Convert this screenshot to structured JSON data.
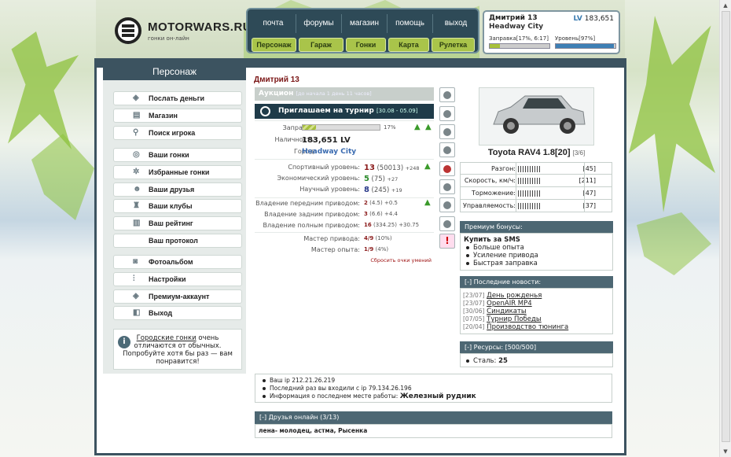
{
  "logo": {
    "name": "MOTORWARS.RU",
    "tagline": "гонки он-лайн"
  },
  "nav": {
    "top": [
      "почта",
      "форумы",
      "магазин",
      "помощь",
      "выход"
    ],
    "buttons": [
      "Персонаж",
      "Гараж",
      "Гонки",
      "Карта",
      "Рулетка"
    ]
  },
  "user": {
    "name": "Дмитрий 13",
    "lv_label": "LV",
    "lv": "183,651",
    "city": "Headway City",
    "fuel_label": "Заправка[17%, 6:17]",
    "level_label": "Уровень[97%]",
    "fuel_pct": 17,
    "level_pct": 97
  },
  "left": {
    "title": "Персонаж",
    "menu": [
      "Послать деньги",
      "Магазин",
      "Поиск игрока",
      "Ваши гонки",
      "Избранные гонки",
      "Ваши друзья",
      "Ваши клубы",
      "Ваш рейтинг",
      "Ваш протокол",
      "Фотоальбом",
      "Настройки",
      "Премиум-аккаунт",
      "Выход"
    ],
    "info_link": "Городские гонки",
    "info_rest": " очень отличаются от обычных. Попробуйте хотя бы раз — вам понравится!"
  },
  "profile": {
    "name": "Дмитрий 13",
    "auction": "Аукцион",
    "auction_note": "[до начала 1 день 11 часов]",
    "tournament": "Приглашаем на турнир",
    "tournament_dates": "[30.08 - 05.09]",
    "fuel_k": "Заправка:",
    "fuel_v": "17%",
    "cash_k": "Наличность:",
    "cash_v": "183,651 LV",
    "city_k": "Город:",
    "city_v": "Headway City",
    "sport_k": "Спортивный уровень:",
    "sport_v": "13",
    "sport_x": "(50013)",
    "sport_d": "+248",
    "eco_k": "Экономический уровень:",
    "eco_v": "5",
    "eco_x": "(75)",
    "eco_d": "+27",
    "sci_k": "Научный уровень:",
    "sci_v": "8",
    "sci_x": "(245)",
    "sci_d": "+19",
    "fwd_k": "Владение передним приводом:",
    "fwd_v": "2",
    "fwd_x": "(4.5)",
    "fwd_d": "+0.5",
    "rwd_k": "Владение задним приводом:",
    "rwd_v": "3",
    "rwd_x": "(6.6)",
    "rwd_d": "+4.4",
    "awd_k": "Владение полным приводом:",
    "awd_v": "16",
    "awd_x": "(334.25)",
    "awd_d": "+30.75",
    "mdrive_k": "Мастер привода:",
    "mdrive_v": "4/9",
    "mdrive_x": "(10%)",
    "mexp_k": "Мастер опыта:",
    "mexp_v": "1/9",
    "mexp_x": "(4%)",
    "reset": "Сбросить очки умений"
  },
  "car": {
    "name": "Toyota RAV4 1.8[20]",
    "count": "[3/6]",
    "stats": [
      {
        "k": "Разгон:",
        "v": "[45]"
      },
      {
        "k": "Скорость, км/ч:",
        "v": "[211]"
      },
      {
        "k": "Торможение:",
        "v": "[47]"
      },
      {
        "k": "Управляемость:",
        "v": "[37]"
      }
    ]
  },
  "premium": {
    "head": "Премиум бонусы:",
    "buy": "Купить за SMS",
    "items": [
      "Больше опыта",
      "Усиление привода",
      "Быстрая заправка"
    ]
  },
  "news": {
    "head": "[-]  Последние новости:",
    "items": [
      {
        "d": "[23/07]",
        "t": "День рожденья"
      },
      {
        "d": "[23/07]",
        "t": "OpenAIR MP4"
      },
      {
        "d": "[30/06]",
        "t": "Синдикаты"
      },
      {
        "d": "[07/05]",
        "t": "Турнир Победы"
      },
      {
        "d": "[20/04]",
        "t": "Производство тюнинга"
      }
    ]
  },
  "resources": {
    "head": "[-]  Ресурсы: [500/500]",
    "item": "Сталь: ",
    "val": "25"
  },
  "bottom": {
    "ip": "Ваш ip 212.21.26.219",
    "last": "Последний раз вы входили с ip 79.134.26.196",
    "work_k": "Информация о последнем месте работы: ",
    "work_v": "Железный рудник"
  },
  "friends": {
    "head": "[-]  Друзья онлайн (3/13)",
    "list": "лена- молодец, астма, Рысенка"
  }
}
